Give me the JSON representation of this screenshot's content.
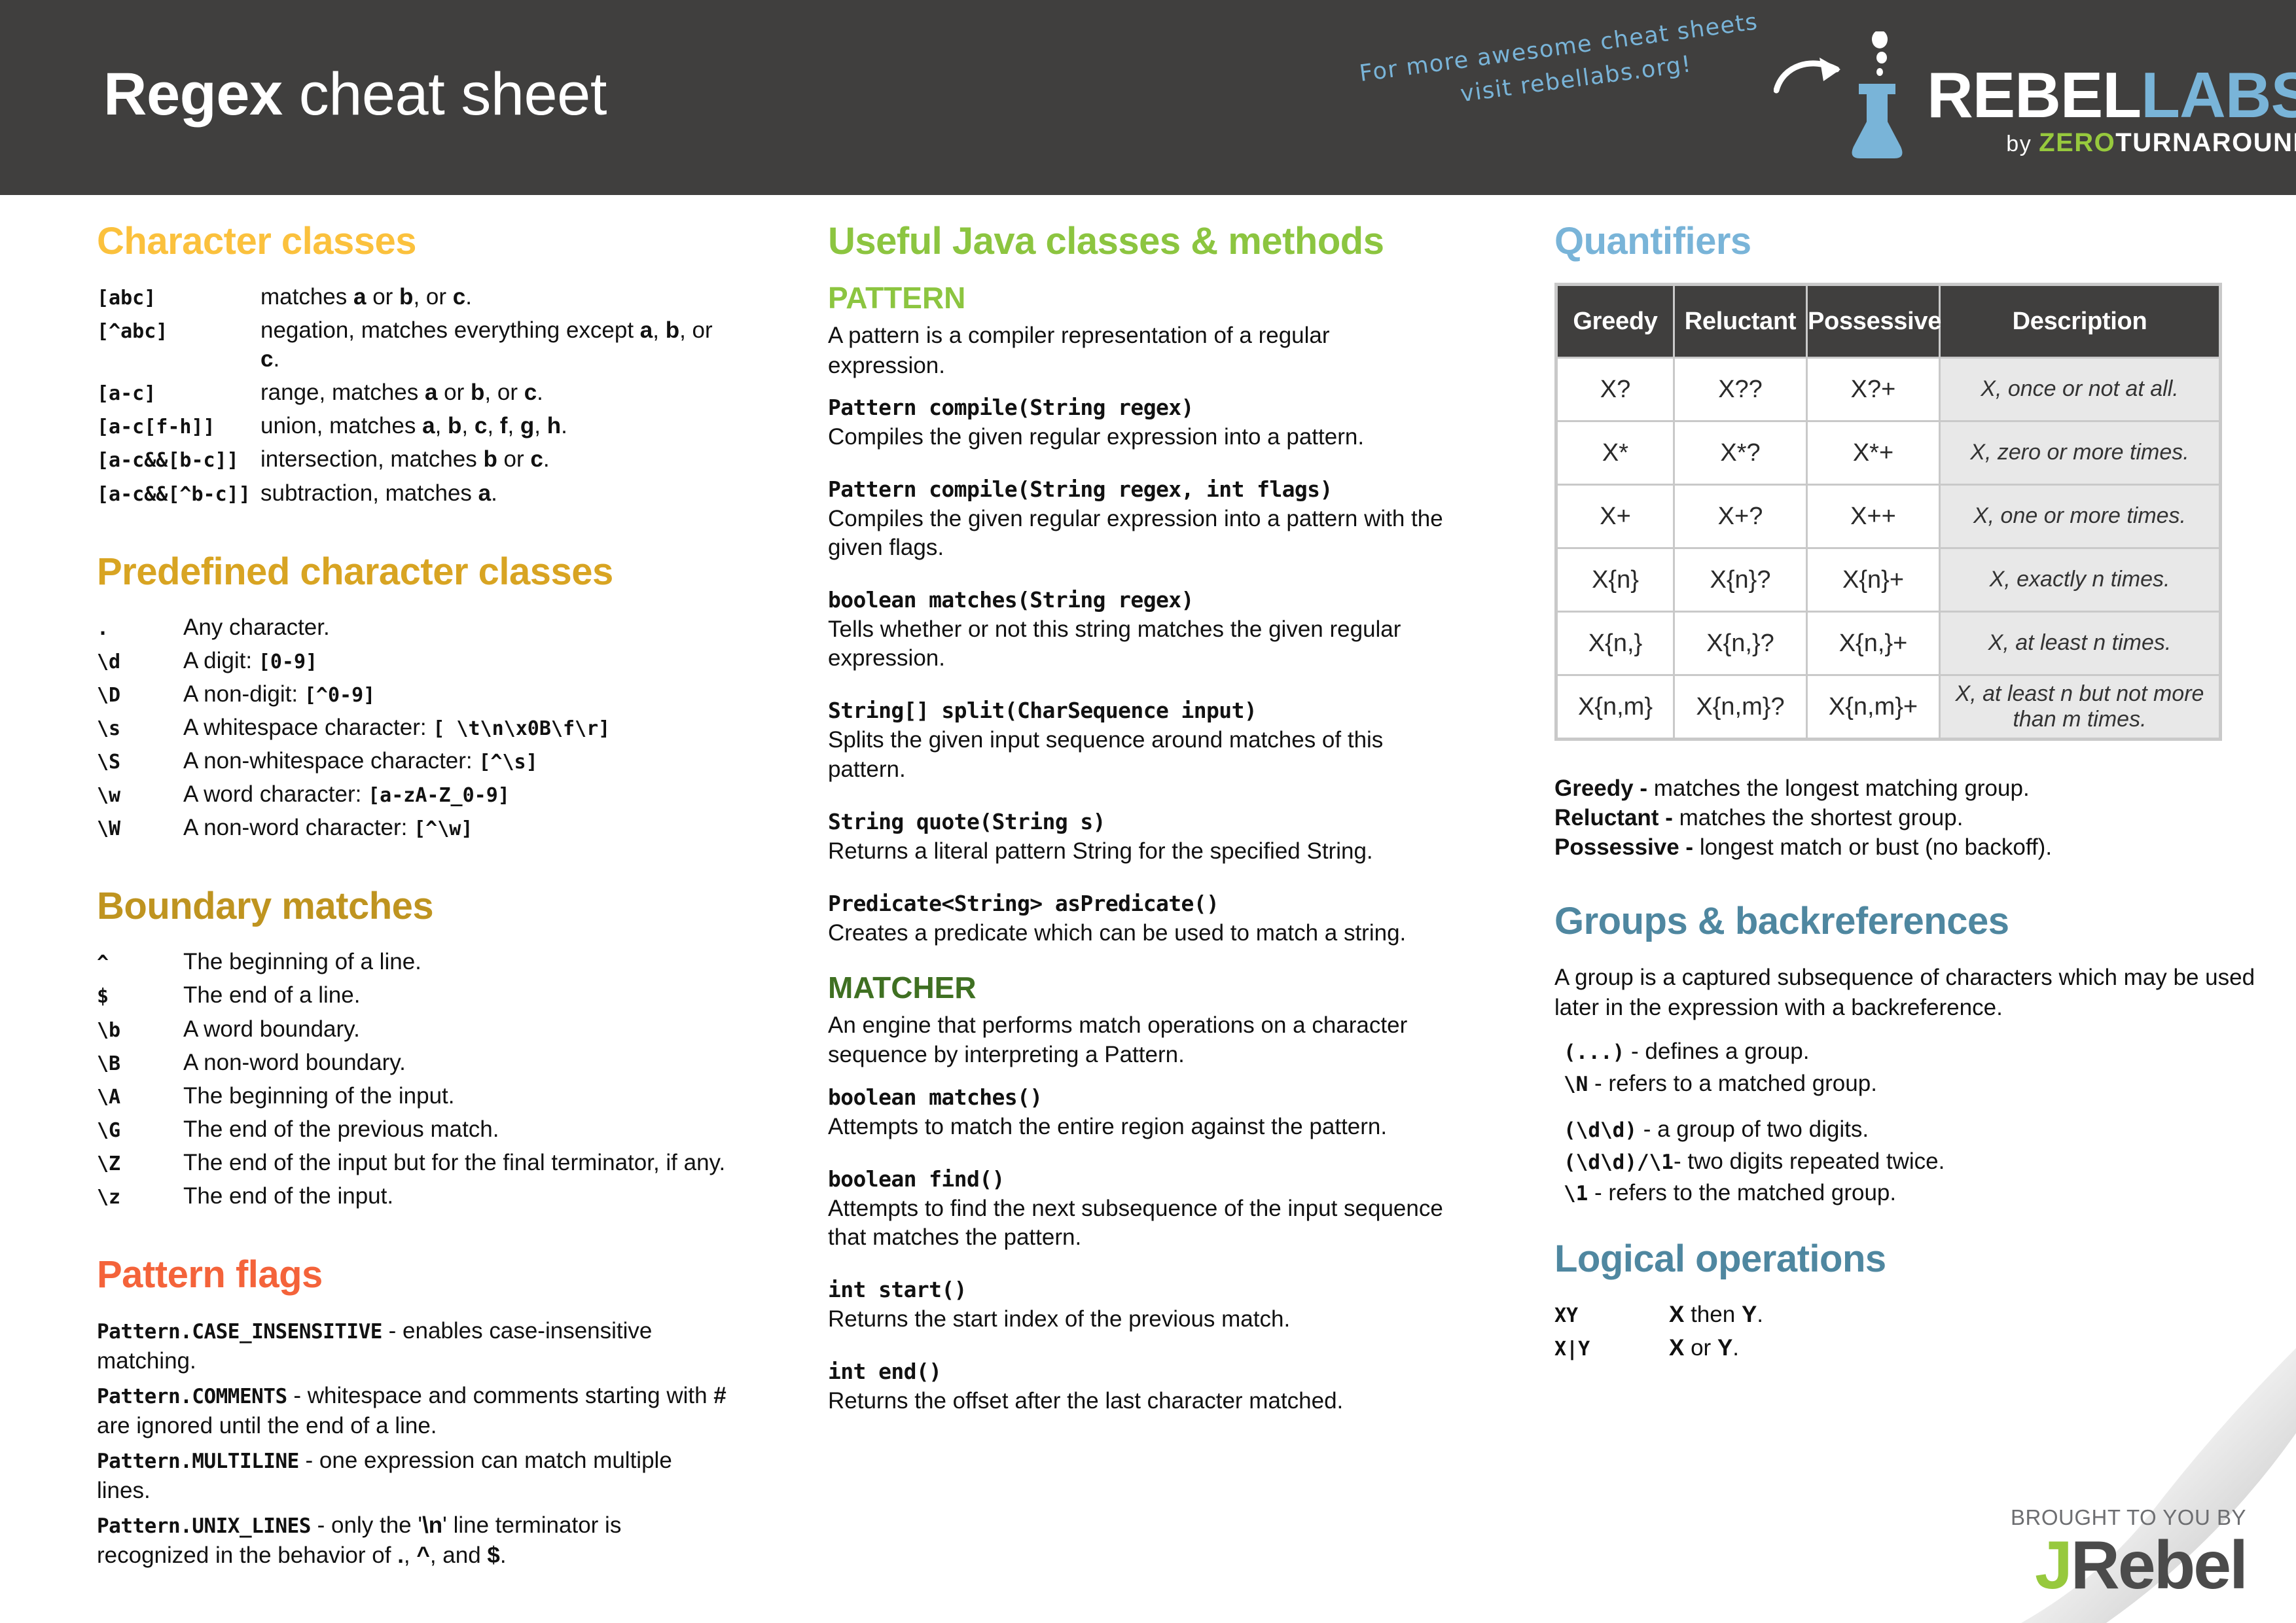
{
  "header": {
    "title_strong": "Regex",
    "title_light": " cheat sheet",
    "promo_line1": "For more awesome cheat sheets",
    "promo_line2": "visit rebellabs.org!",
    "logo_rebel": "REBEL",
    "logo_labs": "LABS",
    "logo_by": "by ",
    "logo_zero": "ZERO",
    "logo_turnaround": "TURNAROUND",
    "bg_color": "#403F3E"
  },
  "character_classes": {
    "heading": "Character classes",
    "color": "#FBC13D",
    "rows": [
      {
        "term": "[abc]",
        "desc": "matches <b>a</b> or <b>b</b>, or <b>c</b>."
      },
      {
        "term": "[^abc]",
        "desc": "negation, matches everything except <b>a</b>, <b>b</b>, or <b>c</b>."
      },
      {
        "term": "[a-c]",
        "desc": "range, matches <b>a</b> or <b>b</b>, or <b>c</b>."
      },
      {
        "term": "[a-c[f-h]]",
        "desc": "union, matches <b>a</b>, <b>b</b>, <b>c</b>, <b>f</b>, <b>g</b>, <b>h</b>."
      },
      {
        "term": "[a-c&&[b-c]]",
        "desc": "intersection, matches <b>b</b> or <b>c</b>."
      },
      {
        "term": "[a-c&&[^b-c]]",
        "desc": "subtraction, matches <b>a</b>."
      }
    ]
  },
  "predefined_classes": {
    "heading": "Predefined character classes",
    "color": "#D8A422",
    "rows": [
      {
        "term": ".",
        "desc": "Any character."
      },
      {
        "term": "\\d",
        "desc": "A digit: <span class='code'>[0-9]</span>"
      },
      {
        "term": "\\D",
        "desc": "A non-digit: <span class='code'>[^0-9]</span>"
      },
      {
        "term": "\\s",
        "desc": "A whitespace character:  <span class='code'>[ \\t\\n\\x0B\\f\\r]</span>"
      },
      {
        "term": "\\S",
        "desc": "A non-whitespace character:  <span class='code'>[^\\s]</span>"
      },
      {
        "term": "\\w",
        "desc": "A word character:  <span class='code'>[a-zA-Z_0-9]</span>"
      },
      {
        "term": "\\W",
        "desc": "A non-word character:  <span class='code'>[^\\w]</span>"
      }
    ]
  },
  "boundary_matches": {
    "heading": "Boundary matches",
    "color": "#BF9420",
    "rows": [
      {
        "term": "^",
        "desc": "The beginning of a line."
      },
      {
        "term": "$",
        "desc": "The end of a line."
      },
      {
        "term": "\\b",
        "desc": "A word boundary."
      },
      {
        "term": "\\B",
        "desc": "A non-word boundary."
      },
      {
        "term": "\\A",
        "desc": "The beginning of the input."
      },
      {
        "term": "\\G",
        "desc": "The end of the previous match."
      },
      {
        "term": "\\Z",
        "desc": "The end of the input but for the final terminator, if any."
      },
      {
        "term": "\\z",
        "desc": "The end of the input."
      }
    ]
  },
  "pattern_flags": {
    "heading": "Pattern flags",
    "color": "#F4633A",
    "items": [
      {
        "html": "<span class='code'>Pattern.CASE_INSENSITIVE</span> - enables case-insensitive matching."
      },
      {
        "html": "<span class='code'>Pattern.COMMENTS</span> - whitespace and comments starting with <b>#</b> are ignored until the end of a line."
      },
      {
        "html": "<span class='code'>Pattern.MULTILINE</span> - one expression can match multiple lines."
      },
      {
        "html": "<span class='code'>Pattern.UNIX_LINES</span> -  only the '<b>\\n</b>' line terminator is recognized in the behavior of <b>.</b>, <b>^</b>, and <b>$</b>."
      }
    ]
  },
  "java_classes": {
    "heading": "Useful Java classes & methods",
    "color": "#8CC540",
    "pattern": {
      "subheading": "PATTERN",
      "subheading_color": "#8CC540",
      "intro": "A pattern is a compiler representation of a regular expression.",
      "methods": [
        {
          "sig": "Pattern compile(String regex)",
          "doc": "Compiles the given regular expression into a pattern."
        },
        {
          "sig": "Pattern compile(String regex, int flags)",
          "doc": "Compiles the given regular expression into a pattern with the given flags."
        },
        {
          "sig": "boolean matches(String regex)",
          "doc": "Tells whether or not this string matches the given regular expression."
        },
        {
          "sig": "String[] split(CharSequence input)",
          "doc": "Splits the given input sequence around matches of this pattern."
        },
        {
          "sig": "String quote(String s)",
          "doc": "Returns a literal pattern String for the specified String."
        },
        {
          "sig": "Predicate<String> asPredicate()",
          "doc": "Creates a predicate which can be used to match a string."
        }
      ]
    },
    "matcher": {
      "subheading": "MATCHER",
      "subheading_color": "#3F7022",
      "intro": "An engine that performs match operations on a character sequence by interpreting a Pattern.",
      "methods": [
        {
          "sig": "boolean matches()",
          "doc": "Attempts to match the entire region against the pattern."
        },
        {
          "sig": "boolean find()",
          "doc": "Attempts to find the next subsequence of the input sequence that matches the pattern."
        },
        {
          "sig": "int start()",
          "doc": "Returns the start index of the previous match."
        },
        {
          "sig": "int end()",
          "doc": "Returns the offset after the last character matched."
        }
      ]
    }
  },
  "quantifiers": {
    "heading": "Quantifiers",
    "color": "#79B4D8",
    "header_bg": "#403F3E",
    "desc_bg": "#E8E8E8",
    "columns": [
      "Greedy",
      "Reluctant",
      "Possessive",
      "Description"
    ],
    "rows": [
      [
        "X?",
        "X??",
        "X?+",
        "X, once or not at all."
      ],
      [
        "X*",
        "X*?",
        "X*+",
        "X, zero or more times."
      ],
      [
        "X+",
        "X+?",
        "X++",
        "X, one or more times."
      ],
      [
        "X{n}",
        "X{n}?",
        "X{n}+",
        "X, exactly n times."
      ],
      [
        "X{n,}",
        "X{n,}?",
        "X{n,}+",
        "X, at least n times."
      ],
      [
        "X{n,m}",
        "X{n,m}?",
        "X{n,m}+",
        "X, at least n but\nnot more than m times."
      ]
    ],
    "notes": [
      {
        "term": "Greedy - ",
        "desc": "matches the longest matching group."
      },
      {
        "term": "Reluctant - ",
        "desc": "matches the shortest group."
      },
      {
        "term": "Possessive - ",
        "desc": "longest match or bust (no backoff)."
      }
    ]
  },
  "groups": {
    "heading": "Groups & backreferences",
    "color": "#79B4D8",
    "intro": "A group is a captured subsequence of characters which may be used later in the expression with a backreference.",
    "lines_a": [
      "<span class='code'>(...)</span> - defines a group.",
      "<span class='code'>\\N</span> -  refers to a matched group."
    ],
    "lines_b": [
      "<span class='code'>(\\d\\d)</span> - a group of two digits.",
      "<span class='code'>(\\d\\d)/\\1</span>- two digits repeated twice.",
      "<span class='code'>\\1</span> - refers to the matched group."
    ]
  },
  "logical_operations": {
    "heading": "Logical operations",
    "color": "#4F87A0",
    "rows": [
      {
        "term": "XY",
        "desc": "<b>X</b> then <b>Y</b>."
      },
      {
        "term": "X|Y",
        "desc": "<b>X</b> or <b>Y</b>."
      }
    ]
  },
  "footer": {
    "byline": "BROUGHT TO YOU BY",
    "jrebel_j": "J",
    "jrebel_rest": "Rebel"
  }
}
